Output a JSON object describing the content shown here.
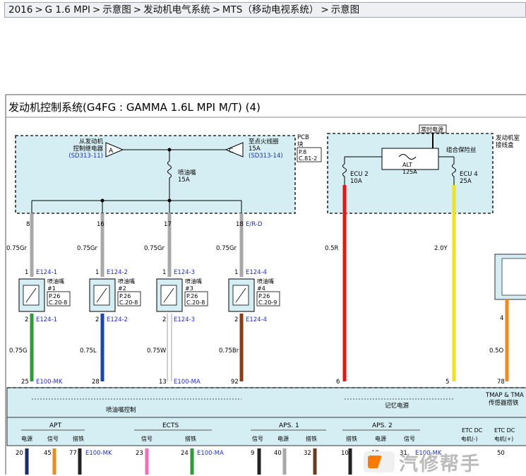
{
  "breadcrumb": {
    "items": [
      "2016",
      "G 1.6 MPI",
      "示意图",
      "发动机电气系统",
      "MTS（移动电视系统）",
      "示意图"
    ],
    "separator": ">"
  },
  "diagram": {
    "title": "发动机控制系统(G4FG : GAMMA 1.6L MPI M/T) (4)",
    "relay_a_label_1": "从发动机",
    "relay_a_label_2": "控制继电器",
    "relay_a_ref": "(SD313-11)",
    "connector_a": "A",
    "connector_c": "C",
    "ign_label_1": "至点火线圈",
    "ign_label_2": "15A",
    "ign_ref": "(SD313-14)",
    "pcb_label_1": "PCB",
    "pcb_label_2": "块",
    "pcb_ref_1": "P.8",
    "pcb_ref_2": "C.81-2",
    "injector_fuse_1": "喷油嘴",
    "injector_fuse_2": "15A",
    "hot_label": "常时电源",
    "alt_label_1": "ALT",
    "alt_label_2": "125A",
    "combo_fuse": "组合保险丝",
    "engine_room_1": "发动机室",
    "engine_room_2": "接线盒",
    "ecu2_1": "ECU 2",
    "ecu2_2": "10A",
    "ecu4_1": "ECU 4",
    "ecu4_2": "25A",
    "erd_label": "E/R-D",
    "injectors": [
      {
        "pin_top": "8",
        "wire_top": "0.75Gr",
        "pin1": "1",
        "conn_top": "E124-1",
        "name_1": "喷油嘴",
        "name_2": "#1",
        "ref_1": "P.26",
        "ref_2": "C.20-8",
        "pin2": "2",
        "conn_bot": "E124-1",
        "wire_bot": "0.75G",
        "pin_ecm": "25",
        "ecm_conn": "E100-MK",
        "pos": "#1",
        "color": "#2e9a3a"
      },
      {
        "pin_top": "16",
        "wire_top": "0.75Gr",
        "pin1": "1",
        "conn_top": "E124-2",
        "name_1": "喷油嘴",
        "name_2": "#2",
        "ref_1": "P.26",
        "ref_2": "C.20-8",
        "pin2": "2",
        "conn_bot": "E124-2",
        "wire_bot": "0.75L",
        "pin_ecm": "28",
        "ecm_conn": "",
        "pos": "#2",
        "color": "#1846b8"
      },
      {
        "pin_top": "17",
        "wire_top": "0.75Gr",
        "pin1": "1",
        "conn_top": "E124-3",
        "name_1": "喷油嘴",
        "name_2": "#3",
        "ref_1": "P.26",
        "ref_2": "C.20-8",
        "pin2": "2",
        "conn_bot": "E124-3",
        "wire_bot": "0.75W",
        "pin_ecm": "13",
        "ecm_conn": "E100-MA",
        "pos": "#3",
        "color": "#ffffff"
      },
      {
        "pin_top": "18",
        "wire_top": "0.75Gr",
        "pin1": "1",
        "conn_top": "E124-4",
        "name_1": "喷油嘴",
        "name_2": "#4",
        "ref_1": "P.26",
        "ref_2": "C.20-9",
        "pin2": "2",
        "conn_bot": "E124-4",
        "wire_bot": "0.75Br",
        "pin_ecm": "92",
        "ecm_conn": "",
        "pos": "#4",
        "color": "#8b3a1a"
      }
    ],
    "red_wire": {
      "label": "0.5R",
      "pin": "6",
      "color": "#e21818"
    },
    "yellow_wire": {
      "label": "2.0Y",
      "pin": "5",
      "color": "#f2e21c"
    },
    "orange_wire": {
      "label": "0.5O",
      "pin_top": "4",
      "pin": "78",
      "color": "#f08a18"
    },
    "injector_control": "喷油嘴控制",
    "memory_power": "记忆电源",
    "tmap_1": "TMAP & TMA",
    "tmap_2": "传感器搭铁",
    "groups": {
      "apt": "APT",
      "ects": "ECTS",
      "aps1": "APS. 1",
      "aps2": "APS. 2",
      "etc_dc_1": "ETC DC",
      "etc_dc_2": "ETC DC"
    },
    "sublabels": {
      "power": "电源",
      "signal": "信号",
      "ground": "搭铁",
      "motor_neg": "电机(-)",
      "motor_pos": "电机(+)"
    },
    "bottom_pins": {
      "p20": "20",
      "p45": "45",
      "p77": "77",
      "e100mk": "E100-MK",
      "p23": "23",
      "p24": "24",
      "e100ma": "E100-MA",
      "p9": "9",
      "p40": "40",
      "p32": "32",
      "p10": "10",
      "p18": "18",
      "p31": "31",
      "e100mk2": "E100-MK",
      "p50": "50"
    },
    "colors": {
      "housing_fill": "#d5eef3",
      "dash": "#2a2a2a",
      "gray_wire": "#a8a8a8",
      "pink_wire": "#f06fb8",
      "green_wire": "#2e9a3a",
      "brown_wire": "#6b3a1a",
      "orange_wire": "#f08a18",
      "black_wire": "#222222",
      "navy_wire": "#1a2e6b"
    }
  },
  "watermark": {
    "text": "汽修帮手",
    "icon": "logo-icon"
  }
}
